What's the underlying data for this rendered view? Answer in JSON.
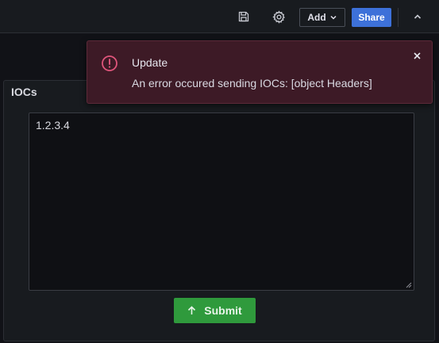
{
  "toolbar": {
    "save_icon": "save-icon",
    "settings_icon": "gear-icon",
    "add_label": "Add",
    "share_label": "Share",
    "collapse_icon": "chevron-up-icon"
  },
  "panel": {
    "title": "IOCs",
    "textarea_value": "1.2.3.4",
    "submit_label": "Submit"
  },
  "toast": {
    "title": "Update",
    "message": "An error occured sending IOCs: [object Headers]",
    "status_color": "#e0557b"
  },
  "colors": {
    "share": "#3d71d9",
    "submit": "#2f9a3c",
    "toast_bg": "#3d1a26"
  }
}
